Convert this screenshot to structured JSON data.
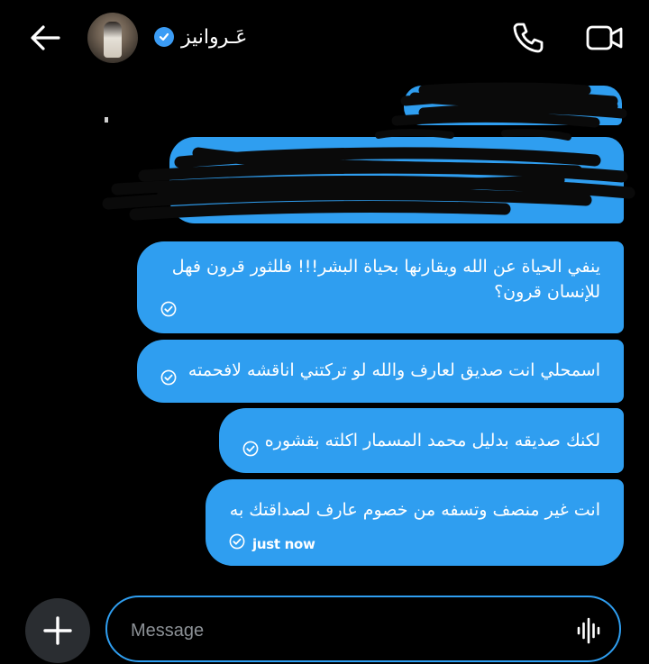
{
  "header": {
    "contact_name": "عَـروانيز",
    "icons": {
      "back": "arrow-left-icon",
      "verified": "verified-check-icon",
      "call": "phone-icon",
      "video": "video-camera-icon"
    }
  },
  "messages": [
    {
      "text": "ينفي الحياة عن الله ويقارنها بحياة البشر!!! فللثور قرون فهل للإنسان قرون؟",
      "status_icon": "seen-check-icon"
    },
    {
      "text": "اسمحلي انت صديق لعارف والله لو تركتني اناقشه لافحمته",
      "status_icon": "seen-check-icon"
    },
    {
      "text": "لكنك صديقه بدليل محمد المسمار اكلته بقشوره",
      "status_icon": "seen-check-icon"
    },
    {
      "text": "انت غير منصف وتسفه من خصوم عارف لصداقتك به",
      "status_icon": "seen-check-icon",
      "time": "just now"
    }
  ],
  "composer": {
    "placeholder": "Message",
    "icons": {
      "plus": "plus-icon",
      "voice": "voice-waveform-icon"
    }
  },
  "colors": {
    "background": "#000000",
    "bubble": "#2f9ef0",
    "plus_button": "#2a2d31",
    "verified": "#3b9cf5"
  }
}
